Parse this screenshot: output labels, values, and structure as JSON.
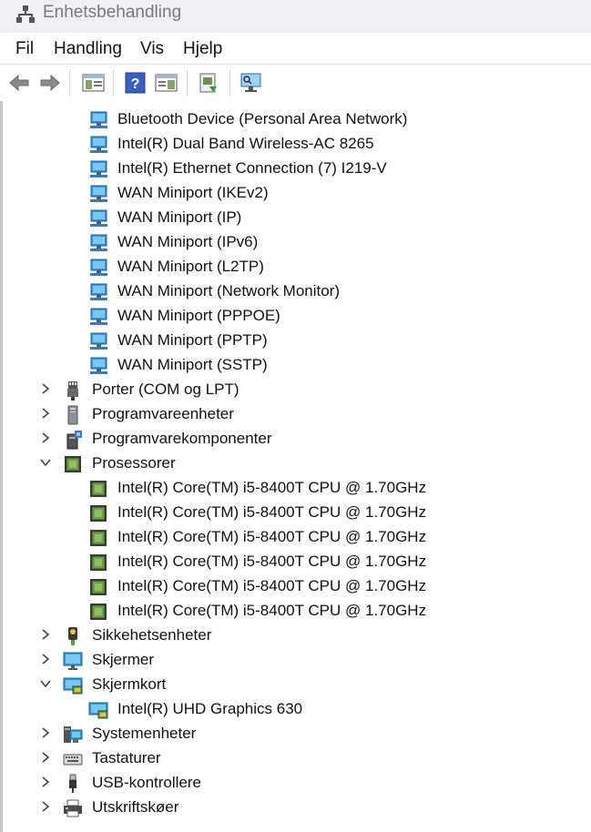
{
  "window": {
    "title": "Enhetsbehandling"
  },
  "menu": [
    "Fil",
    "Handling",
    "Vis",
    "Hjelp"
  ],
  "toolbar": {
    "buttons": [
      "back-arrow-icon",
      "forward-arrow-icon",
      "show-hide-console-tree-icon",
      "help-icon",
      "properties-icon",
      "update-driver-icon",
      "scan-hardware-icon"
    ]
  },
  "tree": [
    {
      "label": "Bluetooth Device (Personal Area Network)",
      "level": 2,
      "icon": "network-adapter-icon"
    },
    {
      "label": "Intel(R) Dual Band Wireless-AC 8265",
      "level": 2,
      "icon": "network-adapter-icon"
    },
    {
      "label": "Intel(R) Ethernet Connection (7) I219-V",
      "level": 2,
      "icon": "network-adapter-icon"
    },
    {
      "label": "WAN Miniport (IKEv2)",
      "level": 2,
      "icon": "network-adapter-icon"
    },
    {
      "label": "WAN Miniport (IP)",
      "level": 2,
      "icon": "network-adapter-icon"
    },
    {
      "label": "WAN Miniport (IPv6)",
      "level": 2,
      "icon": "network-adapter-icon"
    },
    {
      "label": "WAN Miniport (L2TP)",
      "level": 2,
      "icon": "network-adapter-icon"
    },
    {
      "label": "WAN Miniport (Network Monitor)",
      "level": 2,
      "icon": "network-adapter-icon"
    },
    {
      "label": "WAN Miniport (PPPOE)",
      "level": 2,
      "icon": "network-adapter-icon"
    },
    {
      "label": "WAN Miniport (PPTP)",
      "level": 2,
      "icon": "network-adapter-icon"
    },
    {
      "label": "WAN Miniport (SSTP)",
      "level": 2,
      "icon": "network-adapter-icon"
    },
    {
      "label": "Porter (COM og LPT)",
      "level": 1,
      "expanded": false,
      "icon": "port-connector-icon"
    },
    {
      "label": "Programvareenheter",
      "level": 1,
      "expanded": false,
      "icon": "software-device-icon"
    },
    {
      "label": "Programvarekomponenter",
      "level": 1,
      "expanded": false,
      "icon": "software-component-icon"
    },
    {
      "label": "Prosessorer",
      "level": 1,
      "expanded": true,
      "icon": "processor-chip-icon"
    },
    {
      "label": "Intel(R) Core(TM) i5-8400T CPU @ 1.70GHz",
      "level": 2,
      "icon": "processor-chip-icon"
    },
    {
      "label": "Intel(R) Core(TM) i5-8400T CPU @ 1.70GHz",
      "level": 2,
      "icon": "processor-chip-icon"
    },
    {
      "label": "Intel(R) Core(TM) i5-8400T CPU @ 1.70GHz",
      "level": 2,
      "icon": "processor-chip-icon"
    },
    {
      "label": "Intel(R) Core(TM) i5-8400T CPU @ 1.70GHz",
      "level": 2,
      "icon": "processor-chip-icon"
    },
    {
      "label": "Intel(R) Core(TM) i5-8400T CPU @ 1.70GHz",
      "level": 2,
      "icon": "processor-chip-icon"
    },
    {
      "label": "Intel(R) Core(TM) i5-8400T CPU @ 1.70GHz",
      "level": 2,
      "icon": "processor-chip-icon"
    },
    {
      "label": "Sikkehetsenheter",
      "level": 1,
      "expanded": false,
      "icon": "security-key-icon"
    },
    {
      "label": "Skjermer",
      "level": 1,
      "expanded": false,
      "icon": "monitor-icon"
    },
    {
      "label": "Skjermkort",
      "level": 1,
      "expanded": true,
      "icon": "display-adapter-icon"
    },
    {
      "label": "Intel(R) UHD Graphics 630",
      "level": 2,
      "icon": "display-adapter-icon"
    },
    {
      "label": "Systemenheter",
      "level": 1,
      "expanded": false,
      "icon": "system-device-icon"
    },
    {
      "label": "Tastaturer",
      "level": 1,
      "expanded": false,
      "icon": "keyboard-icon"
    },
    {
      "label": "USB-kontrollere",
      "level": 1,
      "expanded": false,
      "icon": "usb-plug-icon"
    },
    {
      "label": "Utskriftskøer",
      "level": 1,
      "expanded": false,
      "icon": "printer-icon"
    }
  ]
}
